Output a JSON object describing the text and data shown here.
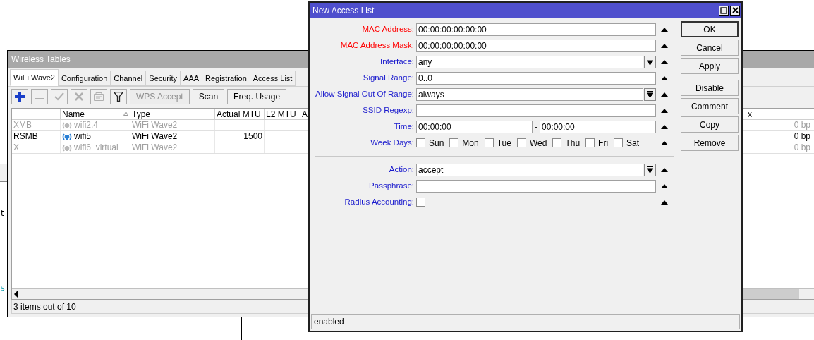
{
  "background_text": [
    {
      "text": "t",
      "kind": "plain"
    },
    {
      "text": "s",
      "kind": "link"
    }
  ],
  "wireless": {
    "title": "Wireless Tables",
    "tabs": [
      {
        "label": "WiFi Wave2",
        "selected": true
      },
      {
        "label": "Configuration",
        "selected": false
      },
      {
        "label": "Channel",
        "selected": false
      },
      {
        "label": "Security",
        "selected": false
      },
      {
        "label": "AAA",
        "selected": false
      },
      {
        "label": "Registration",
        "selected": false
      },
      {
        "label": "Access List",
        "selected": false
      }
    ],
    "toolbar": [
      {
        "kind": "icon",
        "disabled": false
      },
      {
        "kind": "icon",
        "disabled": true
      },
      {
        "kind": "icon",
        "disabled": true
      },
      {
        "kind": "icon",
        "disabled": true
      },
      {
        "kind": "icon",
        "disabled": true
      },
      {
        "kind": "icon",
        "disabled": false
      },
      {
        "kind": "button",
        "label": "WPS Accept",
        "disabled": true
      },
      {
        "kind": "button",
        "label": "Scan",
        "disabled": false
      },
      {
        "kind": "button",
        "label": "Freq. Usage",
        "disabled": false
      }
    ],
    "table": {
      "columns": [
        "",
        "Name",
        "Type",
        "Actual MTU",
        "L2 MTU",
        "A",
        "x"
      ],
      "rows": [
        {
          "flags": "XMB",
          "name": "wifi2.4",
          "type": "WiFi Wave2",
          "actual_mtu": "",
          "l2_mtu": "",
          "column_7": "0 bp",
          "disabled": true
        },
        {
          "flags": "RSMB",
          "name": "wifi5",
          "type": "WiFi Wave2",
          "actual_mtu": "1500",
          "l2_mtu": "",
          "column_7": "0 bp",
          "disabled": false
        },
        {
          "flags": "X",
          "name": "wifi6_virtual",
          "type": "WiFi Wave2",
          "actual_mtu": "",
          "l2_mtu": "",
          "column_7": "0 bp",
          "disabled": true
        }
      ]
    },
    "status_bar": "3 items out of 10"
  },
  "dialog": {
    "title": "New Access List",
    "fields": [
      {
        "kind": "text",
        "label": "MAC Address:",
        "required": true,
        "value": "00:00:00:00:00:00"
      },
      {
        "kind": "text",
        "label": "MAC Address Mask:",
        "required": true,
        "value": "00:00:00:00:00:00"
      },
      {
        "kind": "dropdown",
        "label": "Interface:",
        "required": false,
        "value": "any"
      },
      {
        "kind": "text",
        "label": "Signal Range:",
        "required": false,
        "value": "0..0"
      },
      {
        "kind": "dropdown",
        "label": "Allow Signal Out Of Range:",
        "required": false,
        "value": "always"
      },
      {
        "kind": "text",
        "label": "SSID Regexp:",
        "required": false
      },
      {
        "kind": "range",
        "label": "Time:",
        "required": false,
        "from": "00:00:00",
        "separator": "-",
        "to": "00:00:00"
      },
      {
        "kind": "days",
        "label": "Week Days:",
        "required": false,
        "days": [
          {
            "label": "Sun",
            "checked": false
          },
          {
            "label": "Mon",
            "checked": false
          },
          {
            "label": "Tue",
            "checked": false
          },
          {
            "label": "Wed",
            "checked": false
          },
          {
            "label": "Thu",
            "checked": false
          },
          {
            "label": "Fri",
            "checked": false
          },
          {
            "label": "Sat",
            "checked": false
          }
        ]
      },
      {
        "kind": "separator"
      },
      {
        "kind": "dropdown",
        "label": "Action:",
        "required": false,
        "value": "accept"
      },
      {
        "kind": "text",
        "label": "Passphrase:",
        "required": false
      },
      {
        "kind": "checkbox",
        "label": "Radius Accounting:",
        "required": false,
        "checked": false
      }
    ],
    "button_groups": [
      {
        "buttons": [
          {
            "label": "OK",
            "default": true
          },
          {
            "label": "Cancel",
            "default": false
          },
          {
            "label": "Apply",
            "default": false
          }
        ]
      },
      {
        "buttons": [
          {
            "label": "Disable",
            "default": false
          },
          {
            "label": "Comment",
            "default": false
          },
          {
            "label": "Copy",
            "default": false
          },
          {
            "label": "Remove",
            "default": false
          }
        ]
      }
    ],
    "status_bar": "enabled"
  }
}
